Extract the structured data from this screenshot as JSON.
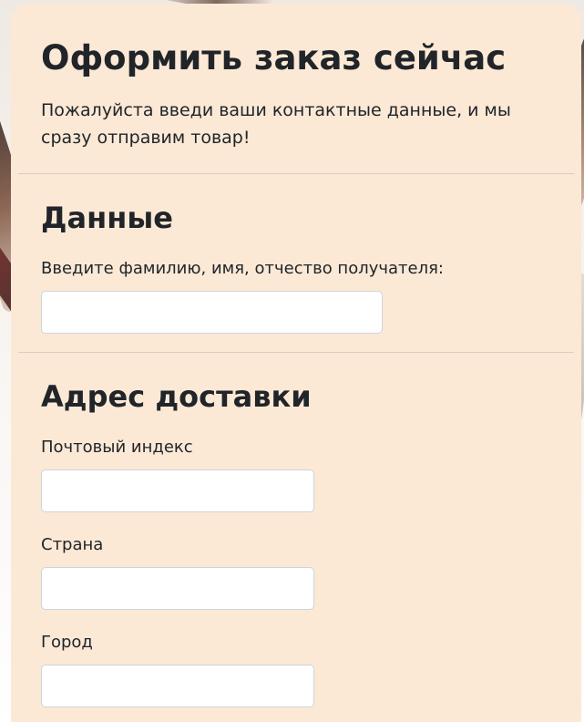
{
  "form": {
    "title": "Оформить заказ сейчас",
    "intro": "Пожалуйста введи ваши контактные данные, и мы сразу отправим товар!",
    "data_section": {
      "heading": "Данные",
      "fullname_label": "Введите фамилию, имя, отчество получателя:",
      "fullname_value": ""
    },
    "address_section": {
      "heading": "Адрес доставки",
      "postal_label": "Почтовый индекс",
      "postal_value": "",
      "country_label": "Страна",
      "country_value": "",
      "city_label": "Город",
      "city_value": ""
    }
  },
  "colors": {
    "card_background": "#fbe9d6",
    "text": "#212529",
    "input_border": "#ced4da"
  }
}
